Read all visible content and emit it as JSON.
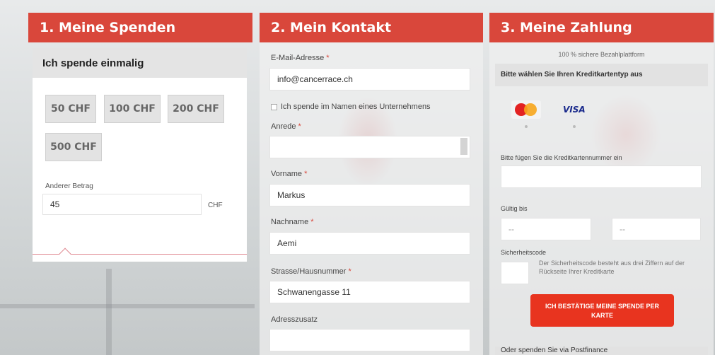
{
  "col1": {
    "title": "1. Meine Spenden",
    "subtitle": "Ich spende einmalig",
    "amounts": [
      "50 CHF",
      "100 CHF",
      "200 CHF",
      "500 CHF"
    ],
    "other_label": "Anderer Betrag",
    "other_value": "45",
    "currency": "CHF"
  },
  "col2": {
    "title": "2. Mein Kontakt",
    "email_label": "E-Mail-Adresse",
    "email_value": "info@cancerrace.ch",
    "company_check_label": "Ich spende im Namen eines Unternehmens",
    "salutation_label": "Anrede",
    "salutation_value": "",
    "firstname_label": "Vorname",
    "firstname_value": "Markus",
    "lastname_label": "Nachname",
    "lastname_value": "Aemi",
    "street_label": "Strasse/Hausnummer",
    "street_value": "Schwanengasse 11",
    "address_extra_label": "Adresszusatz",
    "address_extra_value": "",
    "required_marker": "*"
  },
  "col3": {
    "title": "3. Meine Zahlung",
    "secure_note": "100 % sichere Bezahlplattform",
    "card_type_heading": "Bitte wählen Sie Ihren Kreditkartentyp aus",
    "card_visa": "VISA",
    "card_number_label": "Bitte fügen Sie die Kreditkartennummer ein",
    "valid_label": "Gültig bis",
    "month_value": "--",
    "year_value": "--",
    "cvc_label": "Sicherheitscode",
    "cvc_note": "Der Sicherheitscode besteht aus drei Ziffern auf der Rückseite Ihrer Kreditkarte",
    "submit_label": "ICH BESTÄTIGE MEINE SPENDE PER KARTE",
    "postfinance_heading": "Oder spenden Sie via Postfinance"
  },
  "colors": {
    "accent": "#d9473b",
    "button": "#e8341f"
  }
}
